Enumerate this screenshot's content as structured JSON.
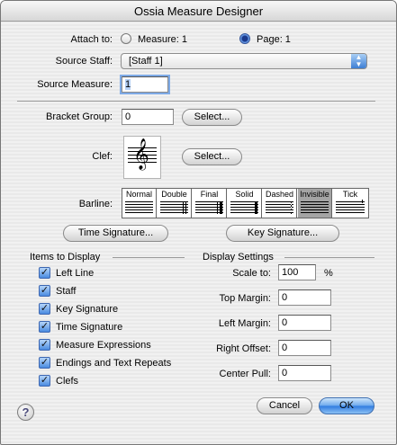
{
  "window": {
    "title": "Ossia Measure Designer"
  },
  "attach": {
    "label": "Attach to:",
    "measure_option": "Measure: 1",
    "page_option": "Page: 1",
    "selected": "page"
  },
  "source_staff": {
    "label": "Source Staff:",
    "value": "[Staff 1]"
  },
  "source_measure": {
    "label": "Source Measure:",
    "value": "1"
  },
  "bracket": {
    "label": "Bracket Group:",
    "value": "0",
    "select_label": "Select..."
  },
  "clef": {
    "label": "Clef:",
    "glyph": "𝄞",
    "select_label": "Select..."
  },
  "barline": {
    "label": "Barline:",
    "options": [
      "Normal",
      "Double",
      "Final",
      "Solid",
      "Dashed",
      "Invisible",
      "Tick"
    ],
    "selected": "Invisible"
  },
  "buttons": {
    "time_signature": "Time Signature...",
    "key_signature": "Key Signature...",
    "cancel": "Cancel",
    "ok": "OK",
    "help": "?"
  },
  "items_to_display": {
    "heading": "Items to Display",
    "items": [
      {
        "label": "Left Line",
        "checked": true
      },
      {
        "label": "Staff",
        "checked": true
      },
      {
        "label": "Key Signature",
        "checked": true
      },
      {
        "label": "Time Signature",
        "checked": true
      },
      {
        "label": "Measure Expressions",
        "checked": true
      },
      {
        "label": "Endings and Text Repeats",
        "checked": true
      },
      {
        "label": "Clefs",
        "checked": true
      }
    ],
    "check_glyph": "✓"
  },
  "display_settings": {
    "heading": "Display Settings",
    "scale_label": "Scale to:",
    "scale_value": "100",
    "scale_unit": "%",
    "top_margin_label": "Top Margin:",
    "top_margin_value": "0",
    "left_margin_label": "Left Margin:",
    "left_margin_value": "0",
    "right_offset_label": "Right Offset:",
    "right_offset_value": "0",
    "center_pull_label": "Center Pull:",
    "center_pull_value": "0"
  },
  "colors": {
    "accent": "#3d7fd4",
    "selected_barline": "#a4a4a4"
  }
}
